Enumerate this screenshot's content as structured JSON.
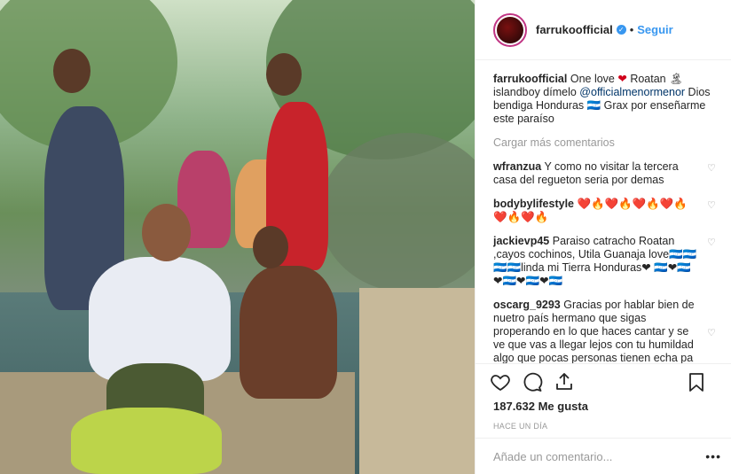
{
  "post": {
    "photo_alt_name": "group-photo",
    "username": "farrukoofficial",
    "follow_label": "Seguir",
    "dot": "•"
  },
  "caption": {
    "username": "farrukoofficial",
    "text_1": "One love",
    "heart": "❤",
    "text_2": "Roatan",
    "trophy": "🏝",
    "text_3": "islandboy dímelo",
    "mention": "@officialmenormenor",
    "text_4": "Dios bendiga Honduras 🇭🇳 Grax por enseñarme este paraíso"
  },
  "load_more": "Cargar más comentarios",
  "comments": [
    {
      "user": "wfranzua",
      "text": "Y como no visitar la tercera casa del regueton seria por demas"
    },
    {
      "user": "bodybylifestyle",
      "text": "❤️🔥❤️🔥❤️🔥❤️🔥❤️🔥❤️🔥"
    },
    {
      "user": "jackievp45",
      "text": "Paraiso catracho Roatan ,cayos cochinos, Utila Guanaja love🇭🇳🇭🇳🇭🇳🇭🇳linda mi Tierra Honduras❤ 🇭🇳❤🇭🇳❤🇭🇳❤🇭🇳❤🇭🇳"
    },
    {
      "user": "oscarg_9293",
      "text": "Gracias por hablar bien de nuetro país hermano que sigas properando en lo que haces cantar y se ve que vas a llegar lejos con tu humildad algo que pocas personas tienen echa pa lante Honduras te"
    }
  ],
  "likes": "187.632 Me gusta",
  "time": "HACE UN DÍA",
  "add_comment_placeholder": "Añade un comentario...",
  "more_label": "•••",
  "colors": {
    "link": "#3897f0",
    "mention": "#003569",
    "muted": "#999999",
    "text": "#262626"
  }
}
